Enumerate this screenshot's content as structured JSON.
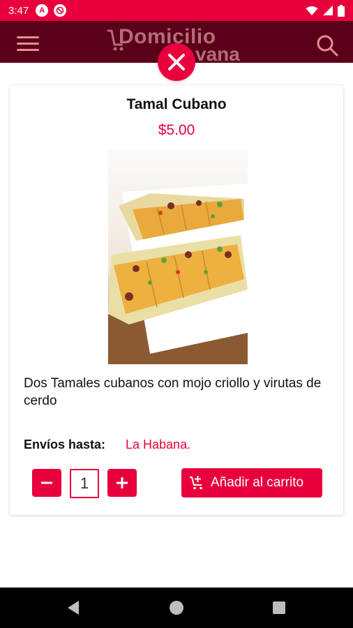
{
  "status_bar": {
    "time": "3:47",
    "icon1": "A",
    "icons": [
      "android-debug-icon",
      "no-sim-icon",
      "wifi-icon",
      "signal-icon",
      "battery-icon"
    ]
  },
  "app_bar": {
    "brand_line1": "Domicilio",
    "brand_line2": "vana",
    "icons": [
      "menu-icon",
      "search-icon"
    ]
  },
  "product": {
    "title": "Tamal Cubano",
    "price": "$5.00",
    "description": "Dos Tamales cubanos con mojo criollo y virutas de cerdo",
    "shipping_label": "Envíos hasta:",
    "shipping_value": "La Habana.",
    "quantity": "1",
    "add_to_cart_label": "Añadir al carrito"
  },
  "colors": {
    "accent": "#e8003d",
    "app_bar": "#5a0019",
    "nav_bar": "#000000"
  }
}
